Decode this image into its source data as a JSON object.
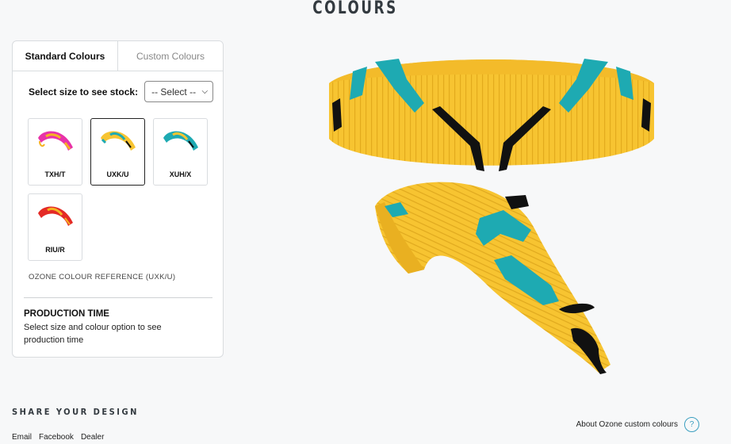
{
  "header": {
    "title": "COLOURS"
  },
  "tabs": {
    "standard": "Standard Colours",
    "custom": "Custom Colours"
  },
  "size": {
    "label": "Select size to see stock:",
    "select_value": "-- Select --"
  },
  "swatches": [
    {
      "code": "TXH/T",
      "primary": "#e832a8",
      "accent": "#f5b322",
      "selected": false
    },
    {
      "code": "UXK/U",
      "primary": "#f7c431",
      "accent": "#1eaab2",
      "selected": true
    },
    {
      "code": "XUH/X",
      "primary": "#1eaab2",
      "accent": "#f7c431",
      "selected": false
    },
    {
      "code": "RIU/R",
      "primary": "#e42a26",
      "accent": "#f5b322",
      "selected": false
    }
  ],
  "reference": "OZONE COLOUR REFERENCE (UXK/U)",
  "production": {
    "title": "PRODUCTION TIME",
    "text": "Select size and colour option to see production time"
  },
  "share": {
    "title": "SHARE YOUR DESIGN",
    "links": [
      "Email",
      "Facebook",
      "Dealer"
    ]
  },
  "about": {
    "label": "About Ozone custom colours",
    "help_icon": "?"
  },
  "colors": {
    "wing_yellow": "#f7c431",
    "wing_teal": "#1eaab2",
    "wing_black": "#111111",
    "accent_blue": "#3b9fc0"
  }
}
